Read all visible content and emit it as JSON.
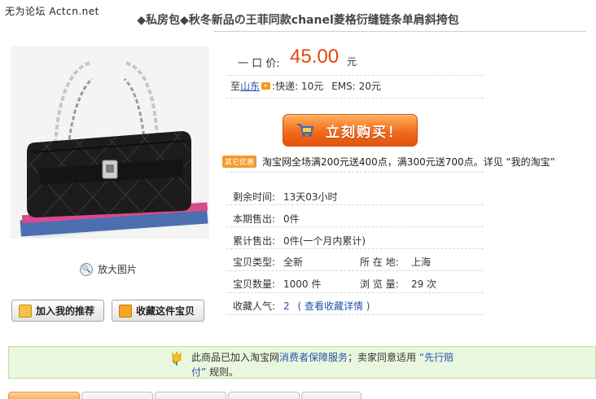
{
  "watermark": "无为论坛 Actcn.net",
  "title": "◆私房包◆秋冬新品の王菲同款chanel菱格衍缝链条单肩斜挎包",
  "image": {
    "icon": "black-quilted-chain-shoulder-bag"
  },
  "zoom": {
    "label": "放大图片"
  },
  "buttons": {
    "recommend": "加入我的推荐",
    "favorite": "收藏这件宝贝"
  },
  "price": {
    "label": "一 口 价:",
    "value": "45.00",
    "unit": "元"
  },
  "shipping": {
    "to_prefix": "至",
    "region": "山东",
    "express": ":快递: 10元",
    "ems": "EMS: 20元"
  },
  "buy_button": {
    "label": "立刻购买！"
  },
  "promo": {
    "badge": "其它优惠",
    "text": "淘宝网全场满200元送400点，满300元送700点。详见 “我的淘宝”"
  },
  "details": {
    "remaining_label": "剩余时间:",
    "remaining_value": "13天03小时",
    "period_sold_label": "本期售出:",
    "period_sold_value": "0件",
    "total_sold_label": "累计售出:",
    "total_sold_value": "0件(一个月内累计)",
    "type_label": "宝贝类型:",
    "type_value": "全新",
    "location_label": "所  在  地:",
    "location_value": "上海",
    "qty_label": "宝贝数量:",
    "qty_value": "1000 件",
    "views_label": "浏  览  量:",
    "views_value": "29 次",
    "fav_label": "收藏人气:",
    "fav_count": "2",
    "fav_link": "( 查看收藏详情 )"
  },
  "guarantee": {
    "pre": "此商品已加入淘宝网",
    "link1": "消费者保障服务",
    "mid": "；卖家同意适用 ",
    "link2": "“先行赔付”",
    "post": " 规则。"
  },
  "colors": {
    "price": "#e7450f",
    "link": "#2455a4",
    "buy": "#f36a1c",
    "guarantee_bg": "#eaf7df"
  }
}
